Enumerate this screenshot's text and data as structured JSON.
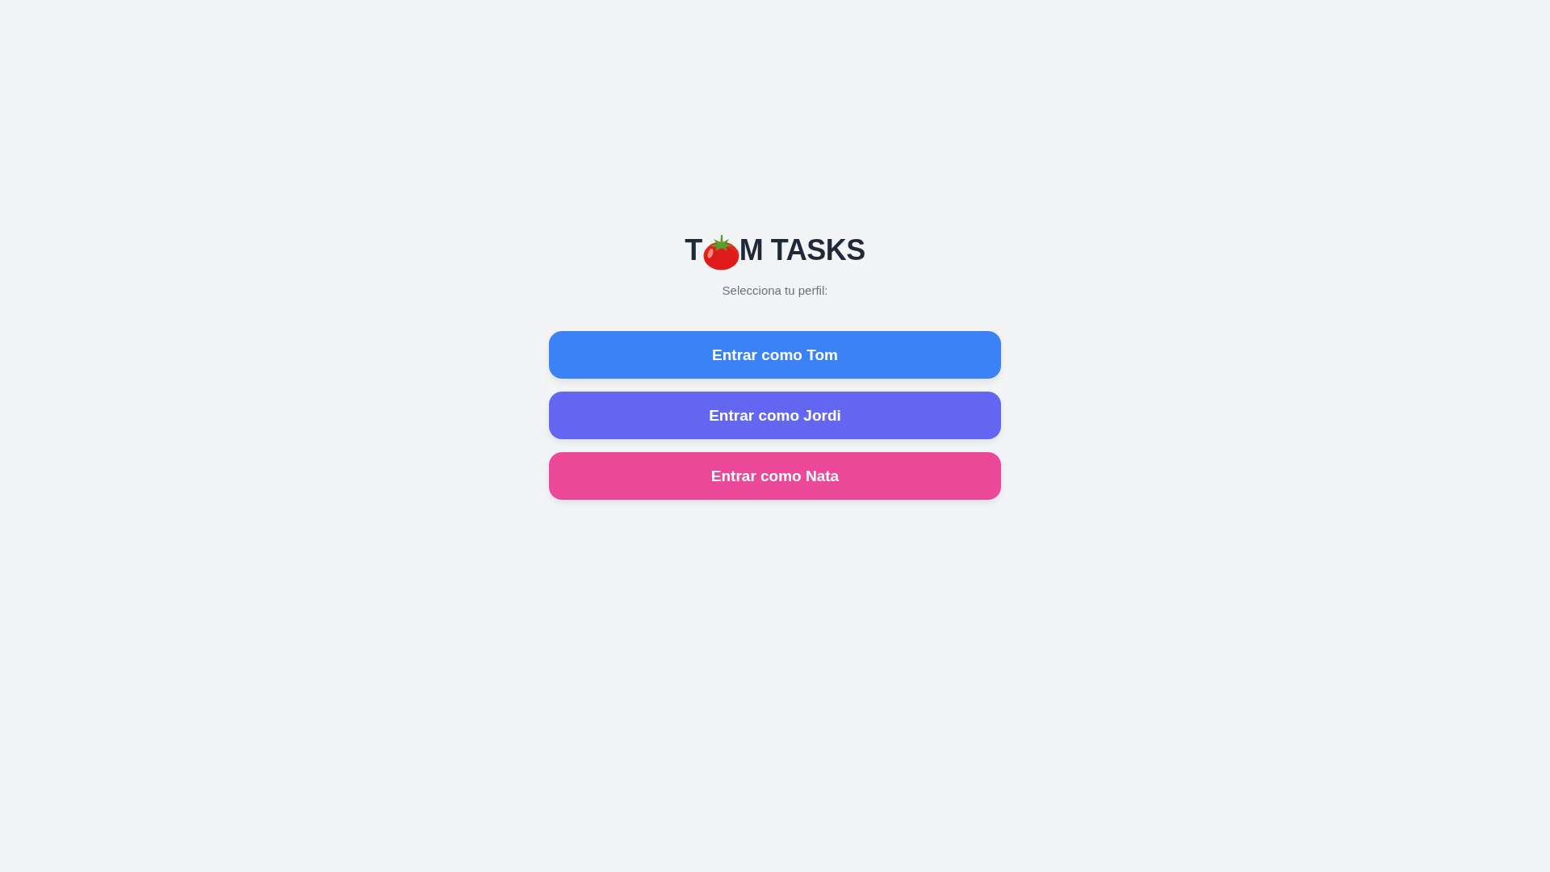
{
  "title": {
    "text_before_icon": "T",
    "text_after_icon": "M TASKS"
  },
  "subtitle": "Selecciona tu perfil:",
  "profile_buttons": [
    {
      "label": "Entrar como Tom",
      "color": "#3b82f6"
    },
    {
      "label": "Entrar como Jordi",
      "color": "#6366f1"
    },
    {
      "label": "Entrar como Nata",
      "color": "#ec4899"
    }
  ]
}
